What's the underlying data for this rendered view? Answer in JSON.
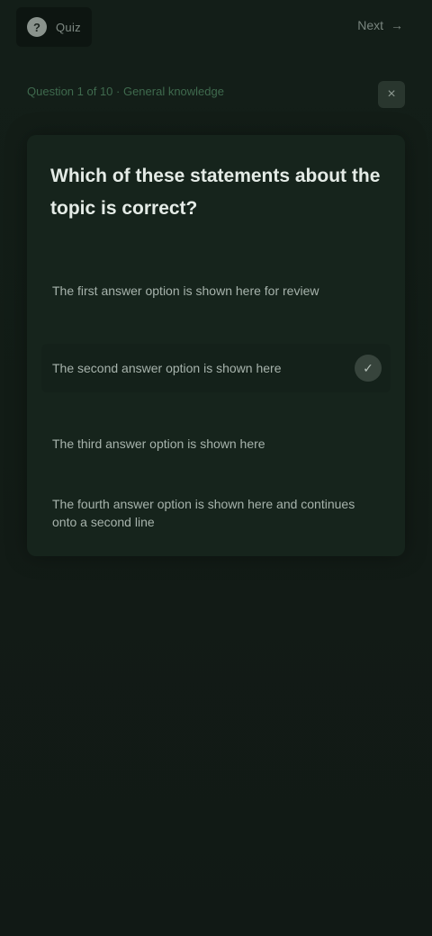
{
  "brand": {
    "logo_glyph": "?",
    "name": "Quiz"
  },
  "top_action": {
    "label": "Next",
    "icon": "arrow-right-icon"
  },
  "breadcrumb": {
    "text": "Question 1 of 10 · General knowledge"
  },
  "close": {
    "icon": "close-icon",
    "glyph": "×"
  },
  "question": {
    "text": "Which of these statements about the topic is correct?"
  },
  "options": [
    {
      "label": "The first answer option is shown here for review"
    },
    {
      "label": "The second answer option is shown here",
      "badge": "✓"
    },
    {
      "label": "The third answer option is shown here"
    },
    {
      "label": "The fourth answer option is shown here and continues onto a second line"
    }
  ],
  "colors": {
    "background": "#111a15",
    "panel": "#16241c",
    "accent": "#3f6a4e"
  }
}
